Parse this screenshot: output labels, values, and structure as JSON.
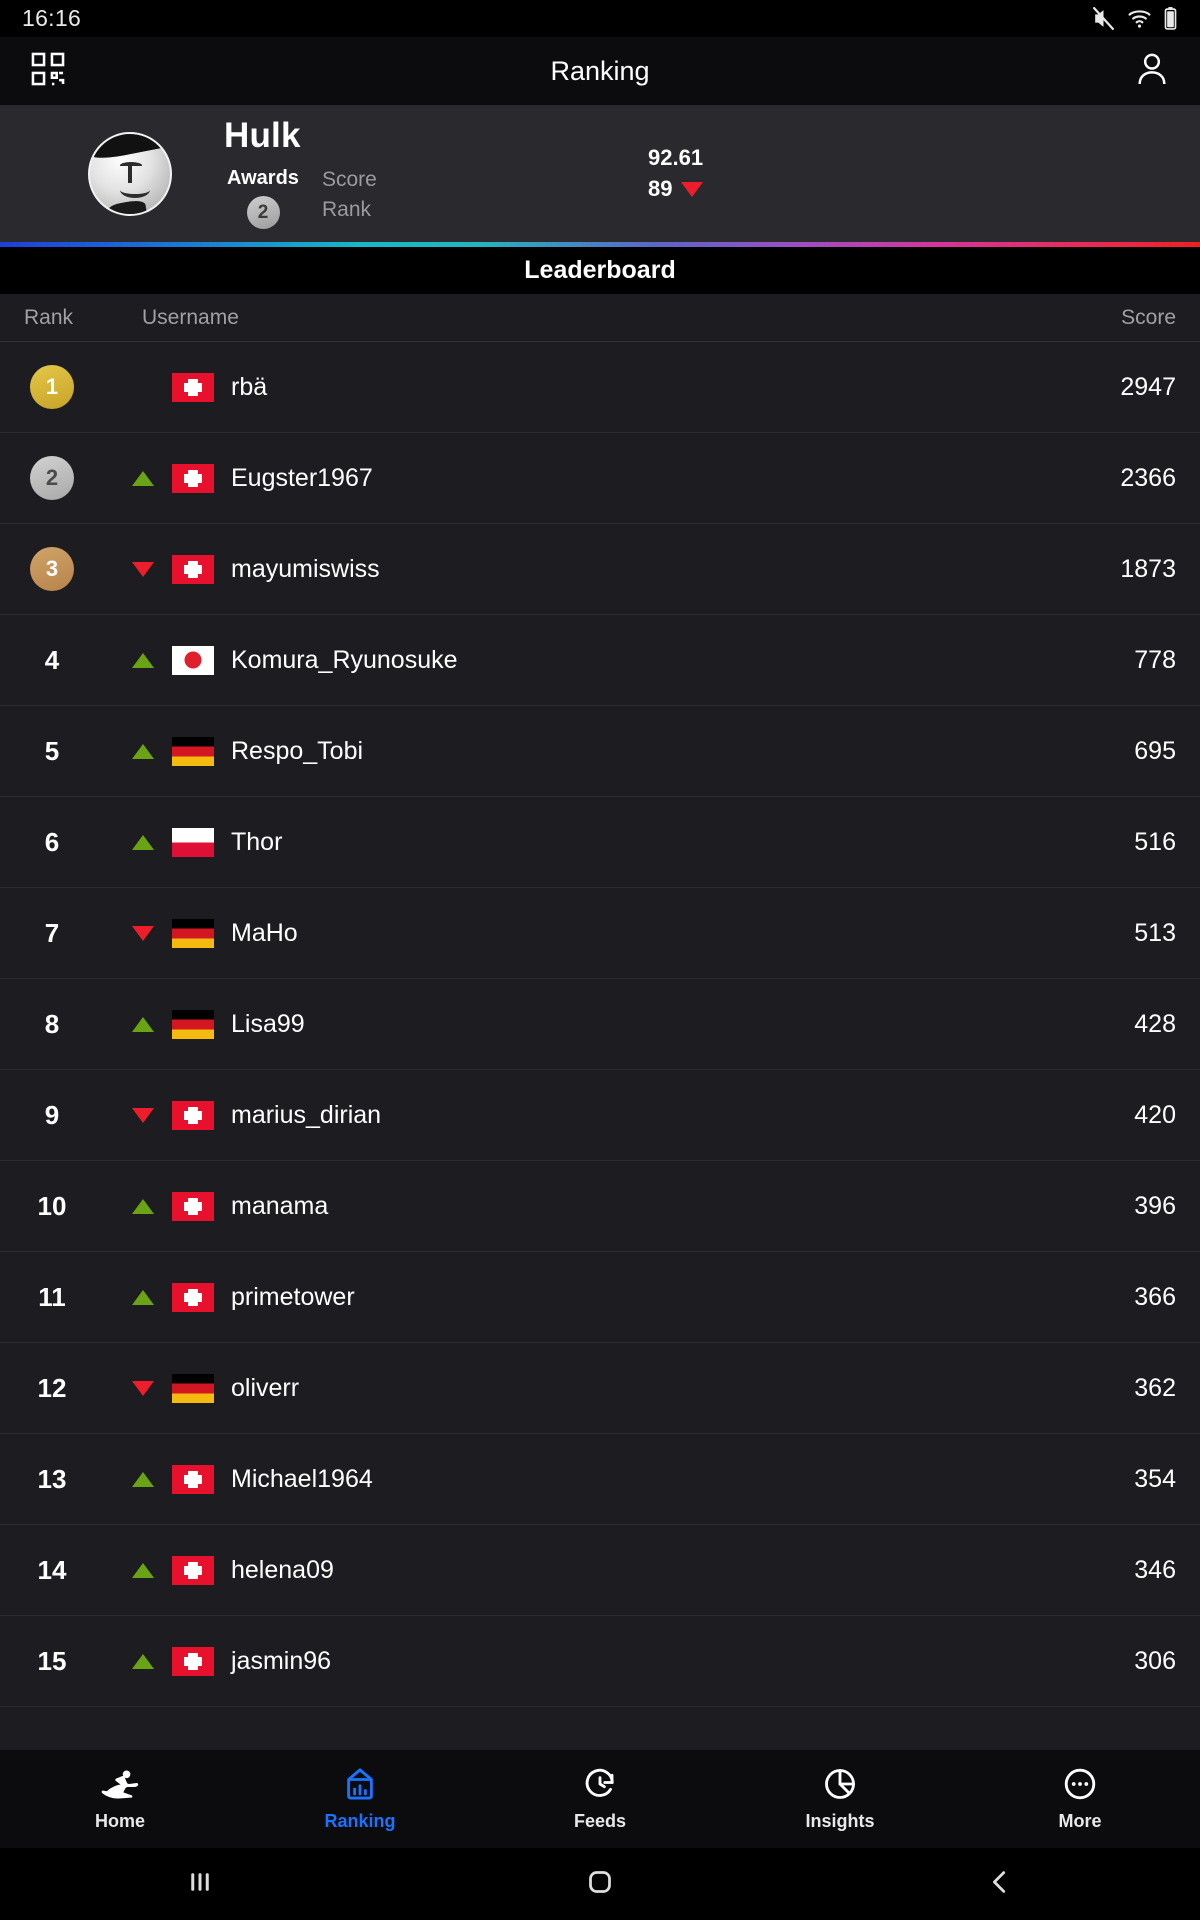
{
  "status_bar": {
    "time": "16:16",
    "icons": [
      "mute-icon",
      "wifi-icon",
      "battery-icon"
    ]
  },
  "app_bar": {
    "left_icon": "qr-code-icon",
    "title": "Ranking",
    "right_icon": "profile-icon"
  },
  "profile": {
    "avatar": "user-avatar",
    "name": "Hulk",
    "awards_label": "Awards",
    "awards_count": "2",
    "score_label": "Score",
    "score_value": "92.61",
    "rank_label": "Rank",
    "rank_value": "89",
    "rank_trend": "down",
    "accent_gradient": [
      "#1f3fd8",
      "#16b8c9",
      "#9a4fc6",
      "#f02020"
    ]
  },
  "leaderboard": {
    "title": "Leaderboard",
    "columns": {
      "rank": "Rank",
      "username": "Username",
      "score": "Score"
    },
    "rows": [
      {
        "rank": "1",
        "medal": "gold",
        "trend": "none",
        "flag": "ch",
        "username": "rbä",
        "score": "2947"
      },
      {
        "rank": "2",
        "medal": "silver",
        "trend": "up",
        "flag": "ch",
        "username": "Eugster1967",
        "score": "2366"
      },
      {
        "rank": "3",
        "medal": "bronze",
        "trend": "down",
        "flag": "ch",
        "username": "mayumiswiss",
        "score": "1873"
      },
      {
        "rank": "4",
        "medal": "none",
        "trend": "up",
        "flag": "jp",
        "username": "Komura_Ryunosuke",
        "score": "778"
      },
      {
        "rank": "5",
        "medal": "none",
        "trend": "up",
        "flag": "de",
        "username": "Respo_Tobi",
        "score": "695"
      },
      {
        "rank": "6",
        "medal": "none",
        "trend": "up",
        "flag": "pl",
        "username": "Thor",
        "score": "516"
      },
      {
        "rank": "7",
        "medal": "none",
        "trend": "down",
        "flag": "de",
        "username": "MaHo",
        "score": "513"
      },
      {
        "rank": "8",
        "medal": "none",
        "trend": "up",
        "flag": "de",
        "username": "Lisa99",
        "score": "428"
      },
      {
        "rank": "9",
        "medal": "none",
        "trend": "down",
        "flag": "ch",
        "username": "marius_dirian",
        "score": "420"
      },
      {
        "rank": "10",
        "medal": "none",
        "trend": "up",
        "flag": "ch",
        "username": "manama",
        "score": "396"
      },
      {
        "rank": "11",
        "medal": "none",
        "trend": "up",
        "flag": "ch",
        "username": "primetower",
        "score": "366"
      },
      {
        "rank": "12",
        "medal": "none",
        "trend": "down",
        "flag": "de",
        "username": "oliverr",
        "score": "362"
      },
      {
        "rank": "13",
        "medal": "none",
        "trend": "up",
        "flag": "ch",
        "username": "Michael1964",
        "score": "354"
      },
      {
        "rank": "14",
        "medal": "none",
        "trend": "up",
        "flag": "ch",
        "username": "helena09",
        "score": "346"
      },
      {
        "rank": "15",
        "medal": "none",
        "trend": "up",
        "flag": "ch",
        "username": "jasmin96",
        "score": "306"
      }
    ]
  },
  "bottom_nav": {
    "active": "Ranking",
    "active_color": "#1a73ff",
    "items": [
      {
        "label": "Home",
        "icon": "running-person-icon"
      },
      {
        "label": "Ranking",
        "icon": "bar-chart-icon"
      },
      {
        "label": "Feeds",
        "icon": "refresh-clock-icon"
      },
      {
        "label": "Insights",
        "icon": "pie-chart-icon"
      },
      {
        "label": "More",
        "icon": "ellipsis-circle-icon"
      }
    ]
  },
  "system_nav": {
    "recents": "recents-icon",
    "home": "home-icon",
    "back": "back-icon"
  }
}
